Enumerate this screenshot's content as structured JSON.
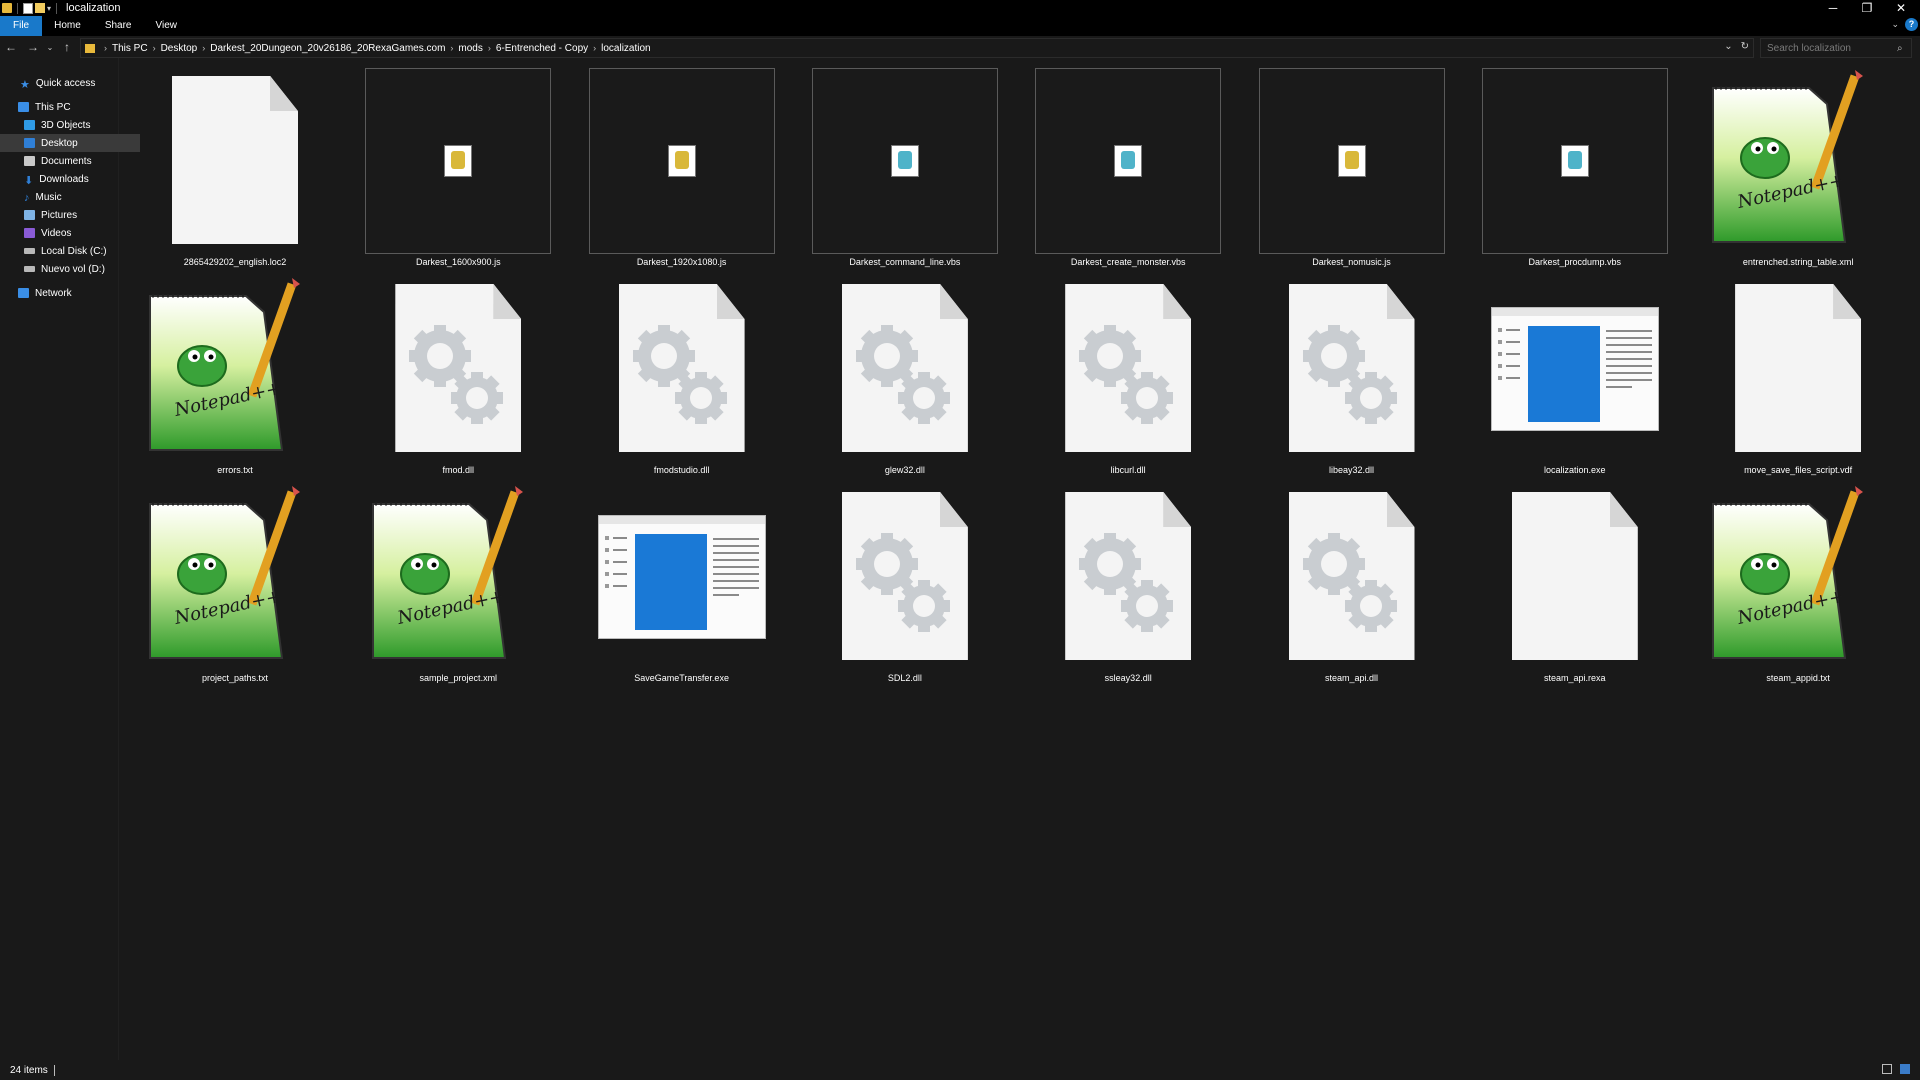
{
  "window": {
    "title": "localization",
    "minimize": "─",
    "restore": "❐",
    "close": "✕"
  },
  "ribbon": {
    "tabs": [
      {
        "label": "File",
        "active": true
      },
      {
        "label": "Home"
      },
      {
        "label": "Share"
      },
      {
        "label": "View"
      }
    ],
    "expand_icon": "chevron-down-icon",
    "help_label": "?"
  },
  "nav": {
    "back": "←",
    "forward": "→",
    "recent": "⌄",
    "up": "↑"
  },
  "address": {
    "crumbs": [
      "This PC",
      "Desktop",
      "Darkest_20Dungeon_20v26186_20RexaGames.com",
      "mods",
      "6-Entrenched - Copy",
      "localization"
    ],
    "refresh": "↻",
    "dropdown": "⌄"
  },
  "search": {
    "placeholder": "Search localization",
    "icon": "search-icon"
  },
  "sidebar": {
    "items": [
      {
        "label": "Quick access",
        "icon": "star-icon",
        "color": "#3a8ee6"
      },
      {
        "label": "This PC",
        "icon": "computer-icon",
        "color": "#3a8ee6"
      },
      {
        "label": "3D Objects",
        "icon": "cube-icon",
        "color": "#2f9be6"
      },
      {
        "label": "Desktop",
        "icon": "desktop-icon",
        "color": "#2f7fd6",
        "selected": true
      },
      {
        "label": "Documents",
        "icon": "documents-icon",
        "color": "#c9c9c9"
      },
      {
        "label": "Downloads",
        "icon": "download-icon",
        "color": "#2f7fd6"
      },
      {
        "label": "Music",
        "icon": "music-icon",
        "color": "#2f7fd6"
      },
      {
        "label": "Pictures",
        "icon": "pictures-icon",
        "color": "#7fb4e6"
      },
      {
        "label": "Videos",
        "icon": "videos-icon",
        "color": "#8a5bd6"
      },
      {
        "label": "Local Disk (C:)",
        "icon": "drive-icon",
        "color": "#b8b8b8"
      },
      {
        "label": "Nuevo vol (D:)",
        "icon": "drive-icon",
        "color": "#b8b8b8"
      },
      {
        "label": "Network",
        "icon": "network-icon",
        "color": "#3a8ee6"
      }
    ]
  },
  "files": [
    {
      "name": "2865429202_english.loc2",
      "type": "blank-doc"
    },
    {
      "name": "Darkest_1600x900.js",
      "type": "script",
      "accent": "#d9b83a"
    },
    {
      "name": "Darkest_1920x1080.js",
      "type": "script",
      "accent": "#d9b83a"
    },
    {
      "name": "Darkest_command_line.vbs",
      "type": "script",
      "accent": "#4fb3c9"
    },
    {
      "name": "Darkest_create_monster.vbs",
      "type": "script",
      "accent": "#4fb3c9"
    },
    {
      "name": "Darkest_nomusic.js",
      "type": "script",
      "accent": "#d9b83a"
    },
    {
      "name": "Darkest_procdump.vbs",
      "type": "script",
      "accent": "#4fb3c9"
    },
    {
      "name": "entrenched.string_table.xml",
      "type": "notepad"
    },
    {
      "name": "errors.txt",
      "type": "notepad"
    },
    {
      "name": "fmod.dll",
      "type": "dll"
    },
    {
      "name": "fmodstudio.dll",
      "type": "dll"
    },
    {
      "name": "glew32.dll",
      "type": "dll"
    },
    {
      "name": "libcurl.dll",
      "type": "dll"
    },
    {
      "name": "libeay32.dll",
      "type": "dll"
    },
    {
      "name": "localization.exe",
      "type": "exe"
    },
    {
      "name": "move_save_files_script.vdf",
      "type": "blank-doc"
    },
    {
      "name": "project_paths.txt",
      "type": "notepad"
    },
    {
      "name": "sample_project.xml",
      "type": "notepad"
    },
    {
      "name": "SaveGameTransfer.exe",
      "type": "exe"
    },
    {
      "name": "SDL2.dll",
      "type": "dll"
    },
    {
      "name": "ssleay32.dll",
      "type": "dll"
    },
    {
      "name": "steam_api.dll",
      "type": "dll"
    },
    {
      "name": "steam_api.rexa",
      "type": "blank-doc"
    },
    {
      "name": "steam_appid.txt",
      "type": "notepad"
    }
  ],
  "notepad_logo_text": "Notepad++",
  "status": {
    "count": "24 items"
  },
  "colors": {
    "background": "#191919",
    "accent": "#1979ca",
    "text": "#ffffff"
  }
}
